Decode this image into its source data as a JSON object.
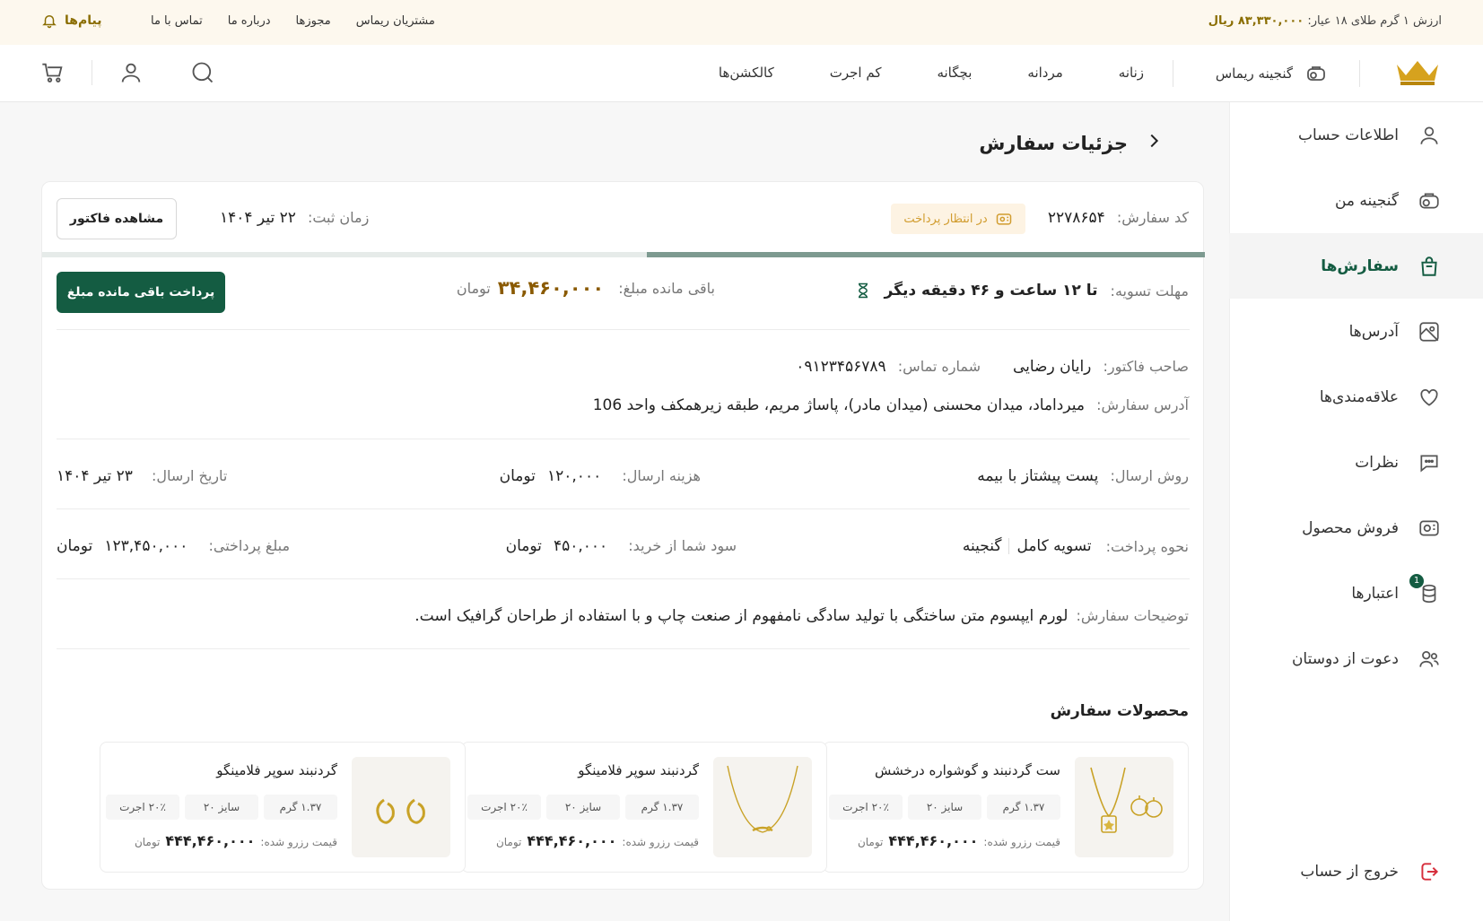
{
  "topbar": {
    "gold_label": "ارزش ۱ گرم طلای ۱۸ عیار:",
    "gold_value": "۸۳,۳۳۰,۰۰۰ ریال",
    "links": [
      "مشتریان ریماس",
      "مجوزها",
      "درباره ما",
      "تماس با ما"
    ],
    "messages": "پیام‌ها"
  },
  "header": {
    "treasure": "گنجینه ریماس",
    "nav": [
      "زنانه",
      "مردانه",
      "بچگانه",
      "کم اجرت",
      "کالکشن‌ها"
    ]
  },
  "sidebar": {
    "items": [
      {
        "label": "اطلاعات حساب",
        "icon": "user-icon"
      },
      {
        "label": "گنجینه من",
        "icon": "treasure-icon"
      },
      {
        "label": "سفارش‌ها",
        "icon": "shopping-bag-icon"
      },
      {
        "label": "آدرس‌ها",
        "icon": "map-icon"
      },
      {
        "label": "علاقه‌مندی‌ها",
        "icon": "heart-icon"
      },
      {
        "label": "نظرات",
        "icon": "comments-icon"
      },
      {
        "label": "فروش محصول",
        "icon": "sell-icon"
      },
      {
        "label": "اعتبارها",
        "icon": "coins-icon",
        "badge": "1"
      },
      {
        "label": "دعوت از دوستان",
        "icon": "users-icon"
      }
    ],
    "logout": "خروج از حساب"
  },
  "page": {
    "title": "جزئیات سفارش"
  },
  "order": {
    "code_label": "کد سفارش:",
    "code_value": "۲۲۷۸۶۵۴",
    "status": "در انتظار پرداخت",
    "time_label": "زمان ثبت:",
    "time_value": "۲۲ تیر ۱۴۰۴",
    "invoice_button": "مشاهده فاکتور",
    "progress_percent": 48,
    "deadline_label": "مهلت تسویه:",
    "deadline_value": "تا ۱۲ ساعت و ۴۶ دقیقه دیگر",
    "remaining_label": "باقی مانده مبلغ:",
    "remaining_value": "۳۴,۴۶۰,۰۰۰",
    "currency": "تومان",
    "pay_button": "پرداخت باقی مانده مبلغ",
    "owner_label": "صاحب فاکتور:",
    "owner_value": "رایان رضایی",
    "phone_label": "شماره تماس:",
    "phone_value": "۰۹۱۲۳۴۵۶۷۸۹",
    "address_label": "آدرس سفارش:",
    "address_value": "میرداماد، میدان محسنی (میدان مادر)، پاساژ مریم، طبقه زیرهمکف واحد 106",
    "ship_method_label": "روش ارسال:",
    "ship_method_value": "پست پیشتاز با بیمه",
    "ship_cost_label": "هزینه ارسال:",
    "ship_cost_value": "۱۲۰,۰۰۰",
    "ship_date_label": "تاریخ ارسال:",
    "ship_date_value": "۲۳ تیر ۱۴۰۴",
    "pay_method_label": "نحوه پرداخت:",
    "pay_method_value1": "تسویه کامل",
    "pay_method_value2": "گنجینه",
    "profit_label": "سود شما از خرید:",
    "profit_value": "۴۵۰,۰۰۰",
    "paid_label": "مبلغ پرداختی:",
    "paid_value": "۱۲۳,۴۵۰,۰۰۰",
    "notes_label": "توضیحات سفارش:",
    "notes_value": "لورم ایپسوم متن ساختگی با تولید سادگی نامفهوم از صنعت چاپ و با استفاده از طراحان گرافیک است.",
    "products_title": "محصولات سفارش"
  },
  "products": [
    {
      "name": "ست گردنبند و گوشواره درخشش",
      "weight": "۱.۳۷ گرم",
      "size": "سایز ۲۰",
      "fee": "۲۰٪ اجرت",
      "price_label": "قیمت رزرو شده:",
      "price": "۴۴۴,۴۶۰,۰۰۰",
      "currency": "تومان",
      "image": "necklace-earring-set"
    },
    {
      "name": "گردنبند سوپر فلامینگو",
      "weight": "۱.۳۷ گرم",
      "size": "سایز ۲۰",
      "fee": "۲۰٪ اجرت",
      "price_label": "قیمت رزرو شده:",
      "price": "۴۴۴,۴۶۰,۰۰۰",
      "currency": "تومان",
      "image": "necklace"
    },
    {
      "name": "گردنبند سوپر فلامینگو",
      "weight": "۱.۳۷ گرم",
      "size": "سایز ۲۰",
      "fee": "۲۰٪ اجرت",
      "price_label": "قیمت رزرو شده:",
      "price": "۴۴۴,۴۶۰,۰۰۰",
      "currency": "تومان",
      "image": "earrings"
    }
  ],
  "colors": {
    "brand_green": "#145c42",
    "gold": "#8a6d00",
    "status_orange": "#d19c2e"
  }
}
